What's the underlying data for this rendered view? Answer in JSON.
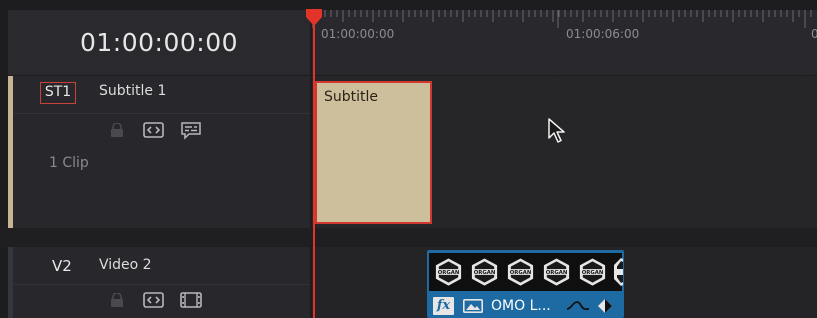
{
  "timecode": "01:00:00:00",
  "ruler": {
    "labels": [
      "01:00:00:00",
      "01:00:06:00",
      "0"
    ]
  },
  "tracks": {
    "subtitle": {
      "id": "ST1",
      "name": "Subtitle 1",
      "clip_count": "1 Clip"
    },
    "video": {
      "id": "V2",
      "name": "Video 2"
    }
  },
  "clips": {
    "subtitle_clip": {
      "label": "Subtitle"
    },
    "video_clip": {
      "name": "OMO L...",
      "fx_label": "fx",
      "thumbnail_text": "ORGAN"
    }
  },
  "colors": {
    "playhead": "#e3342a",
    "subtitle_clip": "#cdbf9c",
    "video_clip": "#1e6aa2",
    "selection_border": "#d0382f"
  },
  "icons": [
    "lock-icon",
    "auto-select-icon",
    "subtitle-captions-icon",
    "film-strip-icon",
    "fx-icon",
    "image-icon",
    "curve-icon",
    "keyframe-icon",
    "mouse-cursor-icon"
  ]
}
